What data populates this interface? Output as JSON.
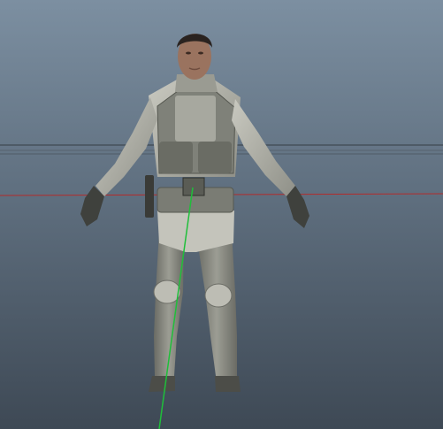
{
  "viewport": {
    "background_top": "#7C8FA1",
    "background_mid": "#5F6F7F",
    "background_bottom": "#3E4955"
  },
  "axes": {
    "x_axis_color": "#B22B2B",
    "y_axis_color": "#1FBF3A",
    "horizon_color": "#4A5560"
  },
  "model": {
    "icon": "character-model",
    "suit_color": "#8E8F86",
    "suit_shadow": "#5C5D56",
    "camo_light": "#CFCFC6",
    "vest_color": "#6E7068",
    "glove_color": "#3F413D",
    "skin_color": "#9A735F",
    "hair_color": "#2A2320"
  }
}
